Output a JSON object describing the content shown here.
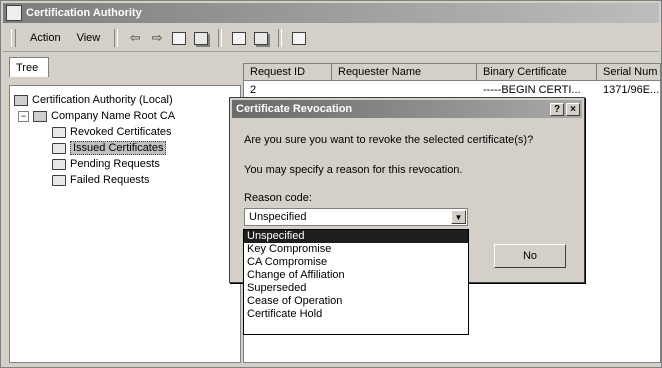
{
  "window": {
    "title": "Certification Authority"
  },
  "toolbar": {
    "menus": [
      "Action",
      "View"
    ],
    "icons": [
      "back-arrow",
      "forward-arrow",
      "up-folder",
      "properties",
      "refresh",
      "export-list",
      "help"
    ]
  },
  "tree": {
    "tab_label": "Tree",
    "root": "Certification Authority (Local)",
    "ca": "Company Name Root CA",
    "children": [
      "Revoked Certificates",
      "Issued Certificates",
      "Pending Requests",
      "Failed Requests"
    ],
    "selected": "Issued Certificates"
  },
  "list": {
    "columns": [
      "Request ID",
      "Requester Name",
      "Binary Certificate",
      "Serial Num"
    ],
    "rows": [
      [
        "2",
        "",
        "-----BEGIN CERTI...",
        "1371/96E..."
      ]
    ]
  },
  "dialog": {
    "title": "Certificate Revocation",
    "question": "Are you sure you want to revoke the selected certificate(s)?",
    "info": "You may specify a reason for this revocation.",
    "reason_label": "Reason code:",
    "reason_value": "Unspecified",
    "no_button": "No"
  },
  "reason_options": [
    "Unspecified",
    "Key Compromise",
    "CA Compromise",
    "Change of Affiliation",
    "Superseded",
    "Cease of Operation",
    "Certificate Hold"
  ]
}
